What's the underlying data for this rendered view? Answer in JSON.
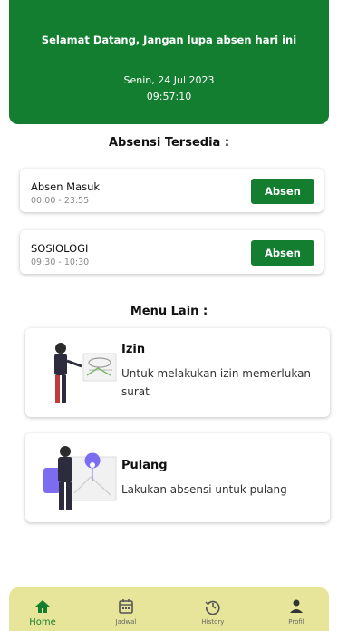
{
  "header": {
    "greeting": "Selamat Datang, Jangan lupa absen hari ini",
    "date": "Senin, 24 Jul 2023",
    "time": "09:57:10"
  },
  "attendance": {
    "title": "Absensi Tersedia :",
    "items": [
      {
        "name": "Absen Masuk",
        "hours": "00:00 - 23:55",
        "button": "Absen"
      },
      {
        "name": "SOSIOLOGI",
        "hours": "09:30 - 10:30",
        "button": "Absen"
      }
    ]
  },
  "menu": {
    "title": "Menu Lain :",
    "items": [
      {
        "title": "Izin",
        "description_line1": "Untuk melakukan izin memerlukan",
        "description_line2": "surat",
        "icon": "permission-letter-illustration"
      },
      {
        "title": "Pulang",
        "description": "Lakukan absensi untuk pulang",
        "icon": "go-home-location-illustration"
      }
    ]
  },
  "nav": {
    "items": [
      {
        "label": "Home",
        "icon": "home-icon"
      },
      {
        "label": "Jadwal",
        "icon": "calendar-icon"
      },
      {
        "label": "History",
        "icon": "history-icon"
      },
      {
        "label": "Profil",
        "icon": "profile-icon"
      }
    ]
  },
  "colors": {
    "primary": "#137e2f",
    "nav_bg": "#e7e59a",
    "accent_illustration": "#7b6cf0"
  }
}
